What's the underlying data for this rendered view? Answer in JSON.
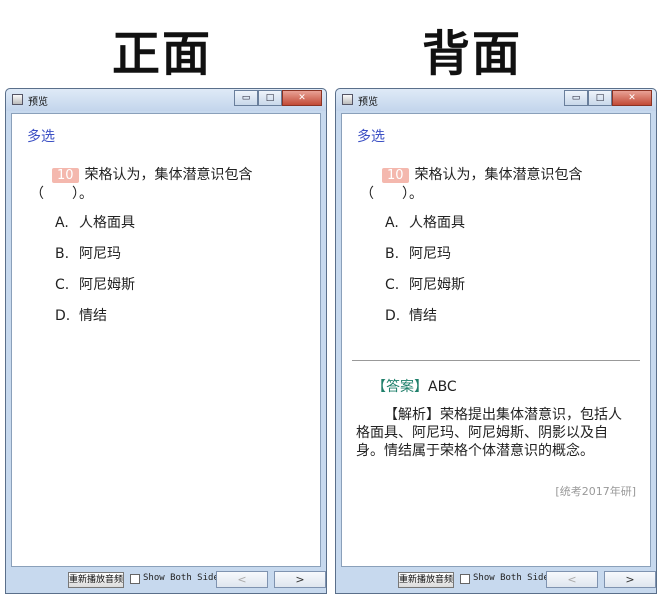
{
  "headings": {
    "front": "正面",
    "back": "背面"
  },
  "window": {
    "title": "预览",
    "controls": {
      "minimize": "▭",
      "maximize": "□",
      "close": "✕"
    }
  },
  "question": {
    "type": "多选",
    "number": "10",
    "stem_line1": "荣格认为，集体潜意识包含",
    "stem_line2": "（　　）。",
    "options": [
      {
        "key": "A.",
        "text": "人格面具"
      },
      {
        "key": "B.",
        "text": "阿尼玛"
      },
      {
        "key": "C.",
        "text": "阿尼姆斯"
      },
      {
        "key": "D.",
        "text": "情结"
      }
    ]
  },
  "answer": {
    "label": "【答案】",
    "value": "ABC",
    "analysis_label": "【解析】",
    "analysis_text": "荣格提出集体潜意识，包括人格面具、阿尼玛、阿尼姆斯、阴影以及自身。情结属于荣格个体潜意识的概念。",
    "source": "[统考2017年研]"
  },
  "bottombar": {
    "replay_label": "重新播放音频",
    "show_both_sides": "Show Both Sides",
    "prev": "<",
    "next": ">"
  }
}
